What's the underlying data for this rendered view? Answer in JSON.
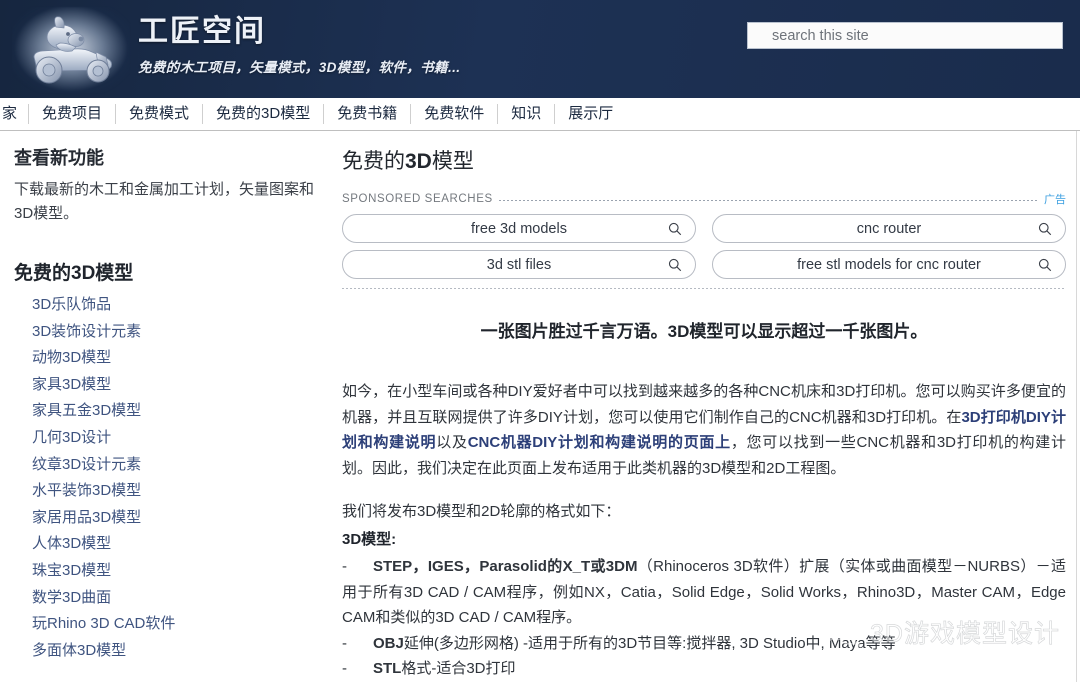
{
  "header": {
    "title": "工匠空间",
    "tagline": "免费的木工项目，矢量模式，3D模型，软件，书籍...",
    "logo_icon": "toy-car-logo-icon",
    "search": {
      "placeholder": "search this site",
      "value": "",
      "icon": "search-icon"
    }
  },
  "nav": {
    "items": [
      {
        "label": "家"
      },
      {
        "label": "免费项目"
      },
      {
        "label": "免费模式"
      },
      {
        "label": "免费的3D模型"
      },
      {
        "label": "免费书籍"
      },
      {
        "label": "免费软件"
      },
      {
        "label": "知识"
      },
      {
        "label": "展示厅"
      }
    ]
  },
  "sidebar": {
    "whats_new_heading": "查看新功能",
    "whats_new_text": "下载最新的木工和金属加工计划，矢量图案和3D模型。",
    "models_heading": "免费的3D模型",
    "links": [
      {
        "label": "3D乐队饰品"
      },
      {
        "label": "3D装饰设计元素"
      },
      {
        "label": "动物3D模型"
      },
      {
        "label": "家具3D模型"
      },
      {
        "label": "家具五金3D模型"
      },
      {
        "label": "几何3D设计"
      },
      {
        "label": "纹章3D设计元素"
      },
      {
        "label": "水平装饰3D模型"
      },
      {
        "label": "家居用品3D模型"
      },
      {
        "label": "人体3D模型"
      },
      {
        "label": "珠宝3D模型"
      },
      {
        "label": "数学3D曲面"
      },
      {
        "label": "玩Rhino 3D CAD软件"
      },
      {
        "label": "多面体3D模型"
      }
    ]
  },
  "main": {
    "title_prefix": "免费的",
    "title_bold": "3D",
    "title_suffix": "模型",
    "sponsored": {
      "label": "SPONSORED SEARCHES",
      "ad_label": "广告",
      "items": [
        {
          "label": "free 3d models",
          "icon": "search-icon"
        },
        {
          "label": "cnc router",
          "icon": "search-icon"
        },
        {
          "label": "3d stl files",
          "icon": "search-icon"
        },
        {
          "label": "free stl models for cnc router",
          "icon": "search-icon"
        }
      ]
    },
    "lede": "一张图片胜过千言万语。3D模型可以显示超过一千张图片。",
    "paragraph1_a": "如今，在小型车间或各种DIY爱好者中可以找到越来越多的各种CNC机床和3D打印机。您可以购买许多便宜的机器，并且互联网提供了许多DIY计划，您可以使用它们制作自己的CNC机器和3D打印机。在",
    "paragraph1_link1": "3D打印机DIY计划和构建说明",
    "paragraph1_b": "以及",
    "paragraph1_link2": "CNC机器DIY计划和构建说明的页面上",
    "paragraph1_c": "，您可以找到一些CNC机器和3D打印机的构建计划。因此，我们决定在此页面上发布适用于此类机器的3D模型和2D工程图。",
    "paragraph2": "我们将发布3D模型和2D轮廓的格式如下：",
    "formats_heading": "3D模型:",
    "bullet1_bold": "STEP，IGES，Parasolid的X_T或3DM",
    "bullet1_rest": "（Rhinoceros 3D软件）扩展（实体或曲面模型－NURBS）－适用于所有3D CAD / CAM程序，例如NX，Catia，Solid Edge，Solid Works，Rhino3D，Master CAM，Edge CAM和类似的3D CAD / CAM程序。",
    "bullet2_bold": "OBJ",
    "bullet2_rest": "延伸(多边形网格) -适用于所有的3D节目等:搅拌器, 3D Studio中, Maya等等",
    "bullet3_bold": "STL",
    "bullet3_rest": "格式-适合3D打印"
  },
  "watermark": {
    "text": "3D游戏模型设计",
    "icon": "wechat-bubble-icon"
  },
  "colors": {
    "header_bg": "#1b2e4f",
    "link_blue": "#3f5480",
    "ad_blue": "#3c9fe0",
    "bold_link": "#2c3f78"
  }
}
